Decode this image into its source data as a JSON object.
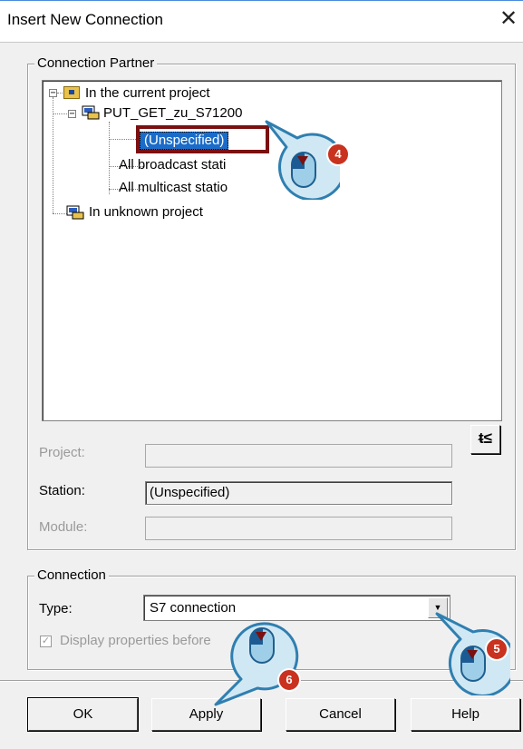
{
  "window": {
    "title": "Insert New Connection",
    "close_glyph": "✕"
  },
  "partner_group": {
    "label": "Connection Partner",
    "tree": {
      "root": "In the current project",
      "station": "PUT_GET_zu_S71200",
      "children": [
        "(Unspecified)",
        "All broadcast stati",
        "All multicast statio"
      ],
      "unknown": "In unknown project"
    },
    "project_label": "Project:",
    "project_value": "",
    "station_label": "Station:",
    "station_value": "(Unspecified)",
    "module_label": "Module:",
    "module_value": "",
    "icon_button": "ᵵ≤"
  },
  "connection_group": {
    "label": "Connection",
    "type_label": "Type:",
    "type_value": "S7 connection",
    "checkbox_label": "Display properties before",
    "checkbox_checked": true
  },
  "buttons": {
    "ok": "OK",
    "apply": "Apply",
    "cancel": "Cancel",
    "help": "Help"
  },
  "callouts": {
    "step4": "4",
    "step5": "5",
    "step6": "6"
  },
  "colors": {
    "selection": "#1b6cc8",
    "highlight_box": "#7a1010",
    "callout_fill": "#cfe8f4",
    "callout_stroke": "#2f7fb0",
    "badge": "#c8321e"
  },
  "icons": [
    "close-icon",
    "folder-icon",
    "station-icon",
    "mouse-icon",
    "dropdown-arrow-icon"
  ]
}
